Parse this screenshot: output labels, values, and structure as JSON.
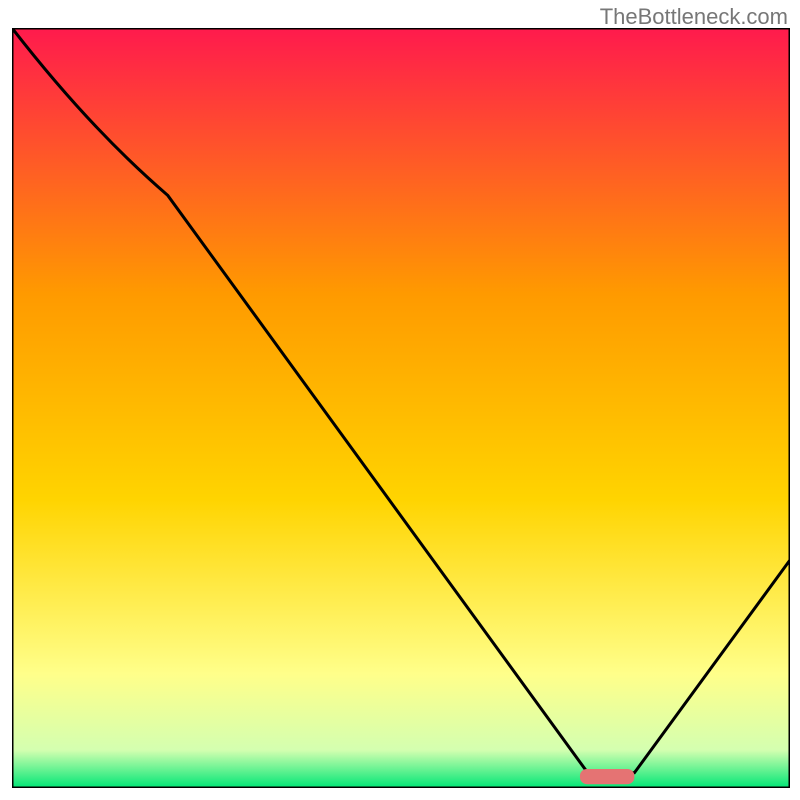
{
  "watermark": "TheBottleneck.com",
  "chart_data": {
    "type": "line",
    "title": "",
    "xlabel": "",
    "ylabel": "",
    "xlim": [
      0,
      100
    ],
    "ylim": [
      0,
      100
    ],
    "grid": false,
    "legend": false,
    "gradient_colors": {
      "top": "#ff1a4d",
      "upper_mid": "#ff7a00",
      "mid": "#ffd400",
      "lower_mid": "#ffffa0",
      "bottom": "#00e676"
    },
    "series": [
      {
        "name": "bottleneck-curve",
        "color": "#000000",
        "x": [
          0,
          20,
          74,
          80,
          100
        ],
        "y": [
          100,
          78,
          2,
          2,
          30
        ]
      }
    ],
    "marker": {
      "name": "optimal-range",
      "color": "#e57373",
      "x_start": 73,
      "x_end": 80,
      "y": 1.5,
      "thickness": 2
    }
  }
}
